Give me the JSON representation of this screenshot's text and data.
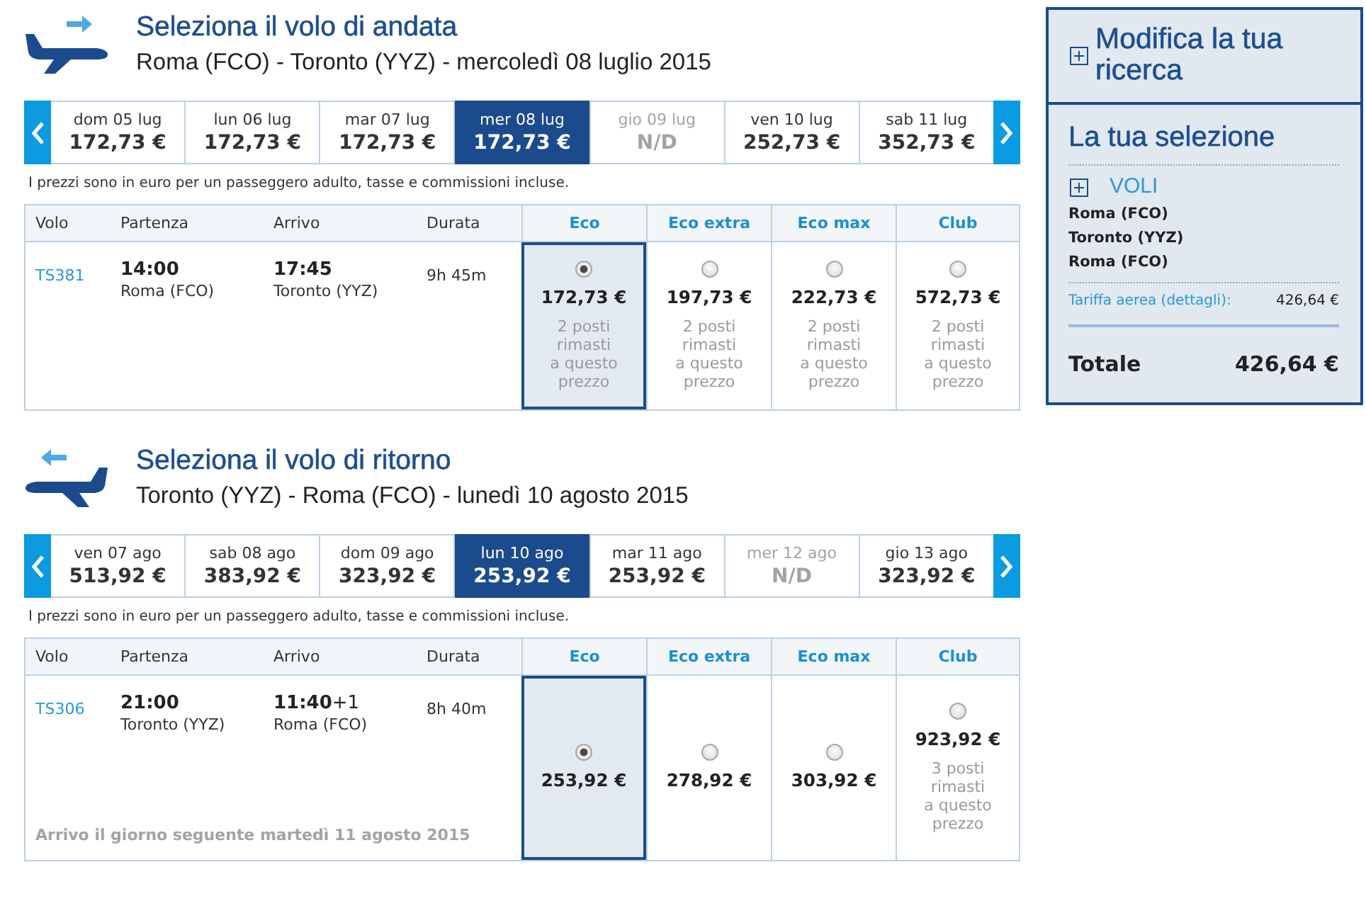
{
  "outbound": {
    "kind": "outbound",
    "title": "Seleziona il volo di andata",
    "route": "Roma (FCO) - Toronto (YYZ) - mercoledì 08 luglio 2015",
    "dates": [
      {
        "day": "dom 05 lug",
        "price": "172,73 €",
        "selected": false,
        "available": true
      },
      {
        "day": "lun 06 lug",
        "price": "172,73 €",
        "selected": false,
        "available": true
      },
      {
        "day": "mar 07 lug",
        "price": "172,73 €",
        "selected": false,
        "available": true
      },
      {
        "day": "mer 08 lug",
        "price": "172,73 €",
        "selected": true,
        "available": true
      },
      {
        "day": "gio 09 lug",
        "price": "N/D",
        "selected": false,
        "available": false
      },
      {
        "day": "ven 10 lug",
        "price": "252,73 €",
        "selected": false,
        "available": true
      },
      {
        "day": "sab 11 lug",
        "price": "352,73 €",
        "selected": false,
        "available": true
      }
    ],
    "note": "I prezzi sono in euro per un passeggero adulto, tasse e commissioni incluse.",
    "table": {
      "columns": [
        {
          "label": "Volo",
          "kind": "info"
        },
        {
          "label": "Partenza",
          "kind": "info"
        },
        {
          "label": "Arrivo",
          "kind": "info"
        },
        {
          "label": "Durata",
          "kind": "info"
        },
        {
          "label": "Eco",
          "kind": "fare"
        },
        {
          "label": "Eco extra",
          "kind": "fare"
        },
        {
          "label": "Eco max",
          "kind": "fare"
        },
        {
          "label": "Club",
          "kind": "fare"
        }
      ],
      "rows": [
        {
          "flight": "TS381",
          "departure": {
            "time": "14:00",
            "place": "Roma (FCO)"
          },
          "arrival": {
            "time": "17:45",
            "place": "Toronto (YYZ)"
          },
          "duration": "9h 45m",
          "fares": [
            {
              "price": "172,73 €",
              "seats_left": "2 posti rimasti a questo prezzo",
              "selected": true
            },
            {
              "price": "197,73 €",
              "seats_left": "2 posti rimasti a questo prezzo",
              "selected": false
            },
            {
              "price": "222,73 €",
              "seats_left": "2 posti rimasti a questo prezzo",
              "selected": false
            },
            {
              "price": "572,73 €",
              "seats_left": "2 posti rimasti a questo prezzo",
              "selected": false
            }
          ]
        }
      ]
    }
  },
  "return": {
    "kind": "return",
    "title": "Seleziona il volo di ritorno",
    "route": "Toronto (YYZ) - Roma (FCO) - lunedì 10 agosto 2015",
    "dates": [
      {
        "day": "ven 07 ago",
        "price": "513,92 €",
        "selected": false,
        "available": true
      },
      {
        "day": "sab 08 ago",
        "price": "383,92 €",
        "selected": false,
        "available": true
      },
      {
        "day": "dom 09 ago",
        "price": "323,92 €",
        "selected": false,
        "available": true
      },
      {
        "day": "lun 10 ago",
        "price": "253,92 €",
        "selected": true,
        "available": true
      },
      {
        "day": "mar 11 ago",
        "price": "253,92 €",
        "selected": false,
        "available": true
      },
      {
        "day": "mer 12 ago",
        "price": "N/D",
        "selected": false,
        "available": false
      },
      {
        "day": "gio 13 ago",
        "price": "323,92 €",
        "selected": false,
        "available": true
      }
    ],
    "note": "I prezzi sono in euro per un passeggero adulto, tasse e commissioni incluse.",
    "table": {
      "columns": [
        {
          "label": "Volo",
          "kind": "info"
        },
        {
          "label": "Partenza",
          "kind": "info"
        },
        {
          "label": "Arrivo",
          "kind": "info"
        },
        {
          "label": "Durata",
          "kind": "info"
        },
        {
          "label": "Eco",
          "kind": "fare"
        },
        {
          "label": "Eco extra",
          "kind": "fare"
        },
        {
          "label": "Eco max",
          "kind": "fare"
        },
        {
          "label": "Club",
          "kind": "fare"
        }
      ],
      "rows": [
        {
          "flight": "TS306",
          "departure": {
            "time": "21:00",
            "place": "Toronto (YYZ)"
          },
          "arrival": {
            "time": "11:40",
            "day_offset": "+1",
            "place": "Roma (FCO)"
          },
          "duration": "8h 40m",
          "footnote": "Arrivo il giorno seguente martedì 11 agosto 2015",
          "fares": [
            {
              "price": "253,92 €",
              "selected": true
            },
            {
              "price": "278,92 €",
              "selected": false
            },
            {
              "price": "303,92 €",
              "selected": false
            },
            {
              "price": "923,92 €",
              "seats_left": "3 posti rimasti a questo prezzo",
              "selected": false
            }
          ]
        }
      ]
    }
  },
  "summary": {
    "modify_search": "Modifica la tua ricerca",
    "title": "La tua selezione",
    "flights_label": "VOLI",
    "route_stops": [
      "Roma (FCO)",
      "Toronto (YYZ)",
      "Roma (FCO)"
    ],
    "fare_label": "Tariffa aerea (dettagli):",
    "fare_amount": "426,64 €",
    "total_label": "Totale",
    "total_amount": "426,64 €"
  }
}
